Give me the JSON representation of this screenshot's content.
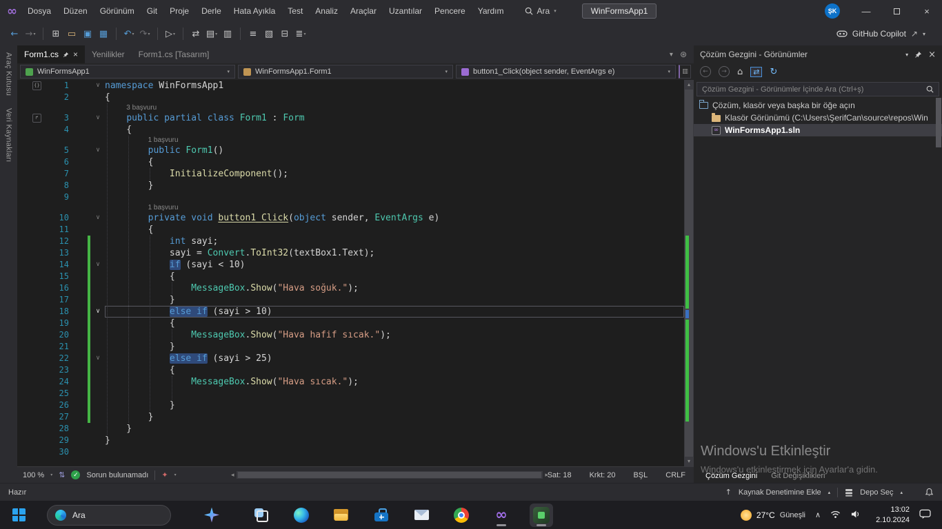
{
  "colors": {
    "accent": "#007acc",
    "keyword": "#569cd6",
    "type": "#4ec9b0",
    "method": "#dcdcaa",
    "string": "#d69d85",
    "line_number": "#2b91af",
    "change_bar": "#45b545",
    "keyword_highlight_bg": "#2f4a7a",
    "codelens": "#8a8a8a",
    "no_problems_check": "#2ea04a"
  },
  "title_bar": {
    "menus": [
      "Dosya",
      "Düzen",
      "Görünüm",
      "Git",
      "Proje",
      "Derle",
      "Hata Ayıkla",
      "Test",
      "Analiz",
      "Araçlar",
      "Uzantılar",
      "Pencere",
      "Yardım"
    ],
    "search_label": "Ara",
    "window_title": "WinFormsApp1",
    "account_initials": "ŞK",
    "window_controls": {
      "minimize": "—",
      "close": "×"
    }
  },
  "toolbar": {
    "icons": [
      {
        "name": "nav-back-icon",
        "glyph": "←",
        "color": "#569cd6"
      },
      {
        "name": "nav-forward-icon",
        "glyph": "→",
        "color": "#6d6d71",
        "dd": true
      },
      {
        "sep": true
      },
      {
        "name": "new-project-icon",
        "glyph": "⊞",
        "color": "#c8c8c8"
      },
      {
        "name": "open-folder-icon",
        "glyph": "▭",
        "color": "#dcb67a"
      },
      {
        "name": "save-icon",
        "glyph": "▣",
        "color": "#569cd6"
      },
      {
        "name": "save-all-icon",
        "glyph": "▦",
        "color": "#569cd6"
      },
      {
        "sep": true
      },
      {
        "name": "undo-icon",
        "glyph": "↶",
        "color": "#569cd6",
        "dd": true
      },
      {
        "name": "redo-icon",
        "glyph": "↷",
        "color": "#6d6d71",
        "dd": true
      },
      {
        "sep": true
      },
      {
        "name": "start-without-debugging-icon",
        "glyph": "▷",
        "color": "#c8c8c8",
        "dd": true
      },
      {
        "sep": true
      },
      {
        "name": "attach-to-process-icon",
        "glyph": "⇄",
        "color": "#c8c8c8"
      },
      {
        "name": "build-icon",
        "glyph": "▤",
        "color": "#c8c8c8",
        "dd": true
      },
      {
        "name": "error-list-icon",
        "glyph": "▥",
        "color": "#c8c8c8"
      },
      {
        "sep": true
      },
      {
        "name": "indent-icon",
        "glyph": "≡",
        "color": "#c8c8c8"
      },
      {
        "name": "comment-icon",
        "glyph": "▧",
        "color": "#c8c8c8"
      },
      {
        "name": "bookmark-icon",
        "glyph": "⊟",
        "color": "#c8c8c8"
      },
      {
        "name": "list-members-icon",
        "glyph": "≣",
        "color": "#c8c8c8",
        "dd": true
      }
    ],
    "copilot_label": "GitHub Copilot"
  },
  "left_tool_tabs": [
    "Araç Kutusu",
    "Veri Kaynakları"
  ],
  "tabs": [
    {
      "label": "Form1.cs",
      "active": true,
      "pinned": true,
      "closable": true
    },
    {
      "label": "Yenilikler"
    },
    {
      "label": "Form1.cs [Tasarım]"
    }
  ],
  "navbar": {
    "project": "WinFormsApp1",
    "type": "WinFormsApp1.Form1",
    "member": "button1_Click(object sender, EventArgs e)"
  },
  "editor": {
    "lines": [
      {
        "n": 1,
        "fold": true,
        "micon": "braces",
        "seg": [
          [
            "namespace ",
            "k"
          ],
          [
            "WinFormsApp1",
            "p"
          ]
        ]
      },
      {
        "n": 2,
        "seg": [
          [
            "{",
            "p"
          ]
        ]
      },
      {
        "n": 3,
        "fold": true,
        "micon": "inherit",
        "lens": {
          "text": "3 başvuru",
          "indent": 4
        },
        "seg": [
          [
            "    ",
            "p"
          ],
          [
            "public partial class ",
            "k"
          ],
          [
            "Form1",
            "t"
          ],
          [
            " : ",
            "p"
          ],
          [
            "Form",
            "t"
          ]
        ]
      },
      {
        "n": 4,
        "seg": [
          [
            "    {",
            "p"
          ]
        ]
      },
      {
        "n": 5,
        "fold": true,
        "lens": {
          "text": "1 başvuru",
          "indent": 8
        },
        "seg": [
          [
            "        ",
            "p"
          ],
          [
            "public ",
            "k"
          ],
          [
            "Form1",
            "t"
          ],
          [
            "()",
            "p"
          ]
        ]
      },
      {
        "n": 6,
        "seg": [
          [
            "        {",
            "p"
          ]
        ]
      },
      {
        "n": 7,
        "seg": [
          [
            "            ",
            "p"
          ],
          [
            "InitializeComponent",
            "m"
          ],
          [
            "();",
            "p"
          ]
        ]
      },
      {
        "n": 8,
        "seg": [
          [
            "        }",
            "p"
          ]
        ]
      },
      {
        "n": 9,
        "seg": []
      },
      {
        "n": 10,
        "fold": true,
        "lens": {
          "text": "1 başvuru",
          "indent": 8
        },
        "seg": [
          [
            "        ",
            "p"
          ],
          [
            "private void ",
            "k"
          ],
          [
            "button1_Click",
            "mu"
          ],
          [
            "(",
            "p"
          ],
          [
            "object",
            "k"
          ],
          [
            " sender, ",
            "p"
          ],
          [
            "EventArgs",
            "t"
          ],
          [
            " e)",
            "p"
          ]
        ]
      },
      {
        "n": 11,
        "seg": [
          [
            "        {",
            "p"
          ]
        ]
      },
      {
        "n": 12,
        "ch": true,
        "seg": [
          [
            "            ",
            "p"
          ],
          [
            "int",
            "k"
          ],
          [
            " sayi;",
            "p"
          ]
        ]
      },
      {
        "n": 13,
        "ch": true,
        "seg": [
          [
            "            sayi = ",
            "p"
          ],
          [
            "Convert",
            "t"
          ],
          [
            ".",
            "p"
          ],
          [
            "ToInt32",
            "m"
          ],
          [
            "(textBox1.Text);",
            "p"
          ]
        ]
      },
      {
        "n": 14,
        "ch": true,
        "fold": true,
        "seg": [
          [
            "            ",
            "p"
          ],
          [
            "if",
            "h"
          ],
          [
            " (sayi < 10)",
            "p"
          ]
        ]
      },
      {
        "n": 15,
        "ch": true,
        "seg": [
          [
            "            {",
            "p"
          ]
        ]
      },
      {
        "n": 16,
        "ch": true,
        "seg": [
          [
            "                ",
            "p"
          ],
          [
            "MessageBox",
            "t"
          ],
          [
            ".",
            "p"
          ],
          [
            "Show",
            "m"
          ],
          [
            "(",
            "p"
          ],
          [
            "\"Hava soğuk.\"",
            "s"
          ],
          [
            ");",
            "p"
          ]
        ]
      },
      {
        "n": 17,
        "ch": true,
        "seg": [
          [
            "            }",
            "p"
          ]
        ]
      },
      {
        "n": 18,
        "ch": true,
        "cur": true,
        "fold": true,
        "seg": [
          [
            "            ",
            "p"
          ],
          [
            "else if",
            "h"
          ],
          [
            " (sayi > 10)",
            "p"
          ]
        ]
      },
      {
        "n": 19,
        "ch": true,
        "seg": [
          [
            "            {",
            "p"
          ]
        ]
      },
      {
        "n": 20,
        "ch": true,
        "seg": [
          [
            "                ",
            "p"
          ],
          [
            "MessageBox",
            "t"
          ],
          [
            ".",
            "p"
          ],
          [
            "Show",
            "m"
          ],
          [
            "(",
            "p"
          ],
          [
            "\"Hava hafif sıcak.\"",
            "s"
          ],
          [
            ");",
            "p"
          ]
        ]
      },
      {
        "n": 21,
        "ch": true,
        "seg": [
          [
            "            }",
            "p"
          ]
        ]
      },
      {
        "n": 22,
        "ch": true,
        "fold": true,
        "seg": [
          [
            "            ",
            "p"
          ],
          [
            "else if",
            "h"
          ],
          [
            " (sayi > 25)",
            "p"
          ]
        ]
      },
      {
        "n": 23,
        "ch": true,
        "seg": [
          [
            "            {",
            "p"
          ]
        ]
      },
      {
        "n": 24,
        "ch": true,
        "seg": [
          [
            "                ",
            "p"
          ],
          [
            "MessageBox",
            "t"
          ],
          [
            ".",
            "p"
          ],
          [
            "Show",
            "m"
          ],
          [
            "(",
            "p"
          ],
          [
            "\"Hava sıcak.\"",
            "s"
          ],
          [
            ");",
            "p"
          ]
        ]
      },
      {
        "n": 25,
        "ch": true,
        "seg": []
      },
      {
        "n": 26,
        "ch": true,
        "seg": [
          [
            "            }",
            "p"
          ]
        ]
      },
      {
        "n": 27,
        "ch": true,
        "seg": [
          [
            "        }",
            "p"
          ]
        ]
      },
      {
        "n": 28,
        "seg": [
          [
            "    }",
            "p"
          ]
        ]
      },
      {
        "n": 29,
        "seg": [
          [
            "}",
            "p"
          ]
        ]
      },
      {
        "n": 30,
        "seg": []
      }
    ]
  },
  "editor_status": {
    "zoom": "100 %",
    "problems": "Sorun bulunamadı",
    "line": "Sat: 18",
    "column": "Krkt: 20",
    "mode": "BŞL",
    "line_ending": "CRLF"
  },
  "solution_explorer": {
    "title": "Çözüm Gezgini - Görünümler",
    "toolbar_icons": [
      "back-circle-icon",
      "forward-circle-icon",
      "home-icon",
      "sync-with-active-document-icon",
      "refresh-icon"
    ],
    "search_placeholder": "Çözüm Gezgini - Görünümler İçinde Ara (Ctrl+ş)",
    "items": [
      {
        "icon": "open-item-icon",
        "label": "Çözüm, klasör veya başka bir öğe açın",
        "indent": 0
      },
      {
        "icon": "folder-icon",
        "label": "Klasör Görünümü (C:\\Users\\ŞerifCan\\source\\repos\\Win",
        "indent": 1
      },
      {
        "icon": "solution-icon",
        "label": "WinFormsApp1.sln",
        "indent": 1,
        "selected": true
      }
    ],
    "bottom_tabs": [
      {
        "label": "Çözüm Gezgini",
        "active": true
      },
      {
        "label": "Git Değişiklikleri"
      }
    ]
  },
  "watermark": {
    "line1": "Windows'u Etkinleştir",
    "line2": "Windows'u etkinleştirmek için Ayarlar'a gidin."
  },
  "status_bar": {
    "ready": "Hazır",
    "add_to_source_control": "Kaynak Denetimine Ekle",
    "select_repo": "Depo Seç"
  },
  "taskbar": {
    "apps": [
      {
        "name": "start-button"
      },
      {
        "name": "taskbar-search",
        "type": "pill",
        "label": "Ara"
      },
      {
        "name": "copilot-icon",
        "gap": 18
      },
      {
        "name": "task-view-icon",
        "gap": 14
      },
      {
        "name": "edge-icon"
      },
      {
        "name": "file-explorer-icon"
      },
      {
        "name": "store-icon"
      },
      {
        "name": "mail-icon"
      },
      {
        "name": "chrome-icon"
      },
      {
        "name": "visual-studio-icon",
        "open": true
      },
      {
        "name": "running-app-icon",
        "open": true,
        "active": true
      }
    ],
    "tray_icons": [
      "tray-expand-icon",
      "network-icon",
      "volume-icon",
      "notifications-icon"
    ],
    "weather_temp": "27°C",
    "weather_condition": "Güneşli",
    "time": "13:02",
    "date": "2.10.2024"
  }
}
